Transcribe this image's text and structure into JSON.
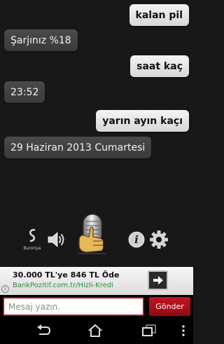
{
  "conversation": [
    {
      "from": "user",
      "text": "kalan pil"
    },
    {
      "from": "bot",
      "text": "Şarjınız %18"
    },
    {
      "from": "user",
      "text": "saat kaç"
    },
    {
      "from": "bot",
      "text": "23:52"
    },
    {
      "from": "user",
      "text": "yarın ayın kaçı"
    },
    {
      "from": "bot",
      "text": "29 Haziran 2013 Cumartesi"
    }
  ],
  "controls": {
    "brand_label": "Buronya",
    "icons": [
      "buronya-logo-icon",
      "speaker-icon",
      "microphone-thumbs-up-icon",
      "info-icon",
      "gear-icon"
    ]
  },
  "ad": {
    "title": "30.000 TL'ye 846 TL Öde",
    "url": "BankPozitif.com.tr/Hizli-Kredi",
    "info_glyph": "i"
  },
  "composer": {
    "placeholder": "Mesaj yazın.",
    "value": "",
    "send_label": "Gönder"
  },
  "navigation": [
    "back-icon",
    "home-icon",
    "recent-apps-icon",
    "overflow-menu-icon"
  ],
  "colors": {
    "accent_red": "#b80e1a",
    "user_bubble": "#e8e8e8",
    "bot_bubble": "#424242",
    "ad_url": "#2f8a3b"
  }
}
